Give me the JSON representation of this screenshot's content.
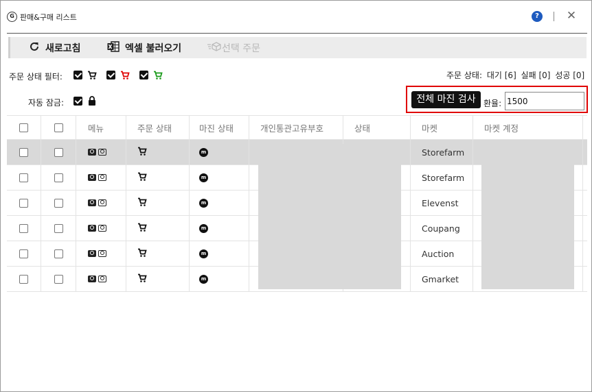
{
  "window": {
    "title": "판매&구매 리스트",
    "help_label": "?",
    "close_label": "✕",
    "app_icon_label": "G"
  },
  "toolbar": {
    "refresh_label": "새로고침",
    "excel_label": "엑셀 불러오기",
    "order_label": "선택 주문"
  },
  "filters": {
    "order_status_label": "주문 상태 필터:",
    "auto_lock_label": "자동 잠금:",
    "cart_colors": [
      "#111111",
      "#e00000",
      "#1a9a1a"
    ]
  },
  "status_summary": {
    "label": "주문 상태:",
    "waiting": "대기 [6]",
    "failed": "실패 [0]",
    "success": "성공 [0]"
  },
  "margin": {
    "check_all_label": "전체 마진 검사",
    "rate_label": "환율:",
    "rate_value": "1500"
  },
  "table": {
    "headers": [
      "메뉴",
      "주문 상태",
      "마진 상태",
      "개인통관고유부호",
      "상태",
      "마켓",
      "마켓 계정"
    ],
    "rows": [
      {
        "market": "Storefarm",
        "selected": true
      },
      {
        "market": "Storefarm",
        "selected": false
      },
      {
        "market": "Elevenst",
        "selected": false
      },
      {
        "market": "Coupang",
        "selected": false
      },
      {
        "market": "Auction",
        "selected": false
      },
      {
        "market": "Gmarket",
        "selected": false
      }
    ]
  },
  "colors": {
    "highlight_border": "#e00000",
    "help_button": "#1e5bbf",
    "selected_row": "#d9d9d9"
  }
}
